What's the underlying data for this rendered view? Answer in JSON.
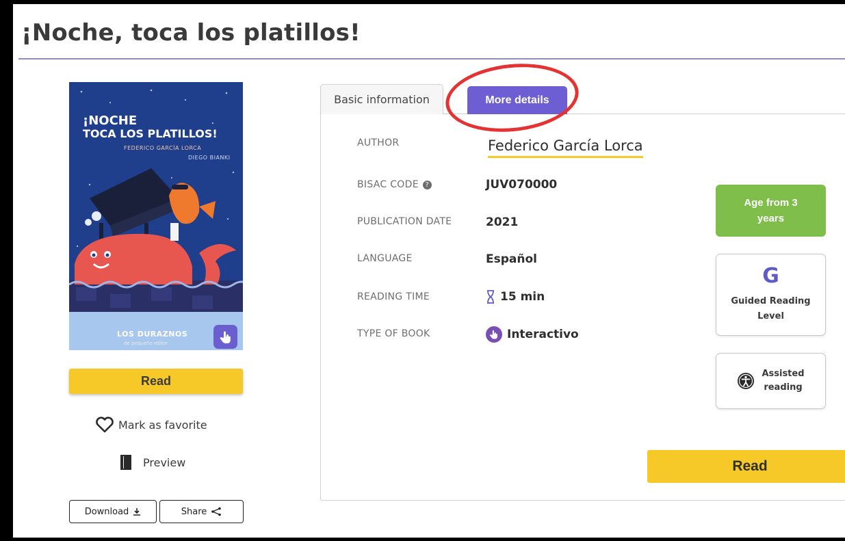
{
  "page": {
    "title": "¡Noche, toca los platillos!"
  },
  "cover": {
    "title_line1": "¡NOCHE",
    "title_line2": "TOCA LOS PLATILLOS!",
    "author": "FEDERICO GARCÍA LORCA",
    "illustrator": "DIEGO BIANKI",
    "publisher": "LOS DURAZNOS",
    "publisher_sub": "de pequeño editor"
  },
  "left": {
    "read_label": "Read",
    "favorite_label": "Mark as favorite",
    "preview_label": "Preview",
    "download_label": "Download",
    "share_label": "Share"
  },
  "tabs": [
    {
      "label": "Basic information",
      "active": false
    },
    {
      "label": "More details",
      "active": true
    }
  ],
  "details": {
    "author_label": "AUTHOR",
    "author_value": "Federico García Lorca",
    "bisac_label": "BISAC CODE",
    "bisac_value": "JUV070000",
    "pubdate_label": "PUBLICATION DATE",
    "pubdate_value": "2021",
    "language_label": "LANGUAGE",
    "language_value": "Español",
    "reading_time_label": "READING TIME",
    "reading_time_value": "15 min",
    "type_label": "TYPE OF BOOK",
    "type_value": "Interactivo"
  },
  "badges": {
    "age_line1": "Age from 3",
    "age_line2": "years",
    "guided_letter": "G",
    "guided_line1": "Guided Reading",
    "guided_line2": "Level",
    "assisted_line1": "Assisted",
    "assisted_line2": "reading"
  },
  "right": {
    "read_label": "Read"
  },
  "colors": {
    "accent_purple": "#6d5fd3",
    "read_yellow": "#f7c928",
    "age_green": "#7fbe4a",
    "highlight_red": "#e53232"
  },
  "icons": [
    "heart-icon",
    "book-icon",
    "download-icon",
    "share-icon",
    "question-icon",
    "hourglass-icon",
    "interactive-hand-icon",
    "accessibility-icon"
  ]
}
